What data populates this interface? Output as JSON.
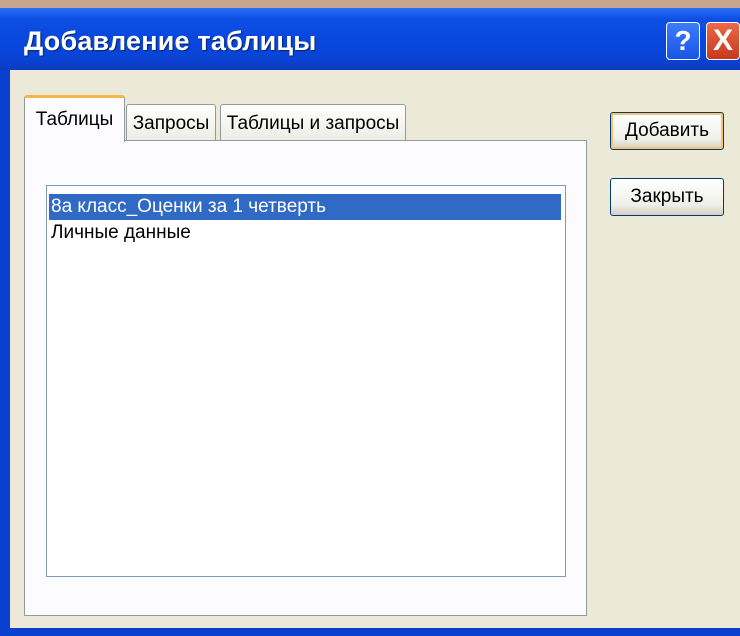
{
  "window": {
    "title": "Добавление таблицы",
    "help_label": "?",
    "close_label": "X"
  },
  "tabs": [
    {
      "label": "Таблицы",
      "active": true
    },
    {
      "label": "Запросы",
      "active": false
    },
    {
      "label": "Таблицы и запросы",
      "active": false
    }
  ],
  "list": {
    "items": [
      {
        "label": "8а класс_Оценки за 1 четверть",
        "selected": true
      },
      {
        "label": "Личные данные",
        "selected": false
      }
    ]
  },
  "buttons": {
    "add_label": "Добавить",
    "close_label": "Закрыть"
  },
  "colors": {
    "titlebar": "#0a44d6",
    "dialog_bg": "#ece9d8",
    "selection": "#316ac5",
    "active_tab_accent": "#f7b64c"
  }
}
